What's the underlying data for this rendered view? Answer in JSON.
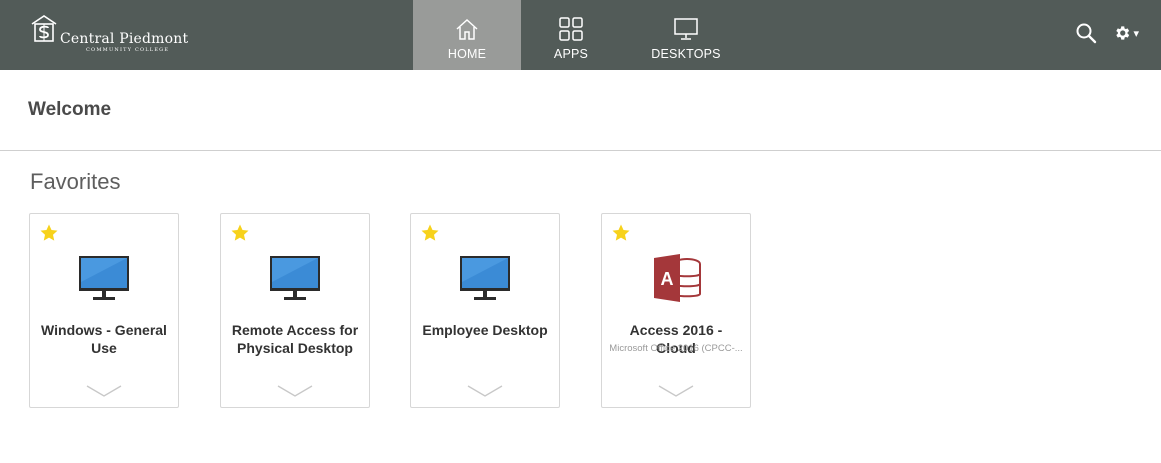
{
  "logo": {
    "name": "Central Piedmont",
    "subtitle": "Community College"
  },
  "nav": {
    "items": [
      {
        "label": "HOME",
        "icon": "home-icon",
        "active": true
      },
      {
        "label": "APPS",
        "icon": "apps-grid-icon",
        "active": false
      },
      {
        "label": "DESKTOPS",
        "icon": "monitor-icon",
        "active": false
      }
    ]
  },
  "tools": {
    "search_icon": "search-icon",
    "settings_icon": "gear-icon",
    "settings_caret": "▾"
  },
  "welcome": {
    "title": "Welcome"
  },
  "favorites": {
    "title": "Favorites",
    "items": [
      {
        "title": "Windows - General Use",
        "subtitle": "",
        "icon": "desktop-monitor-icon",
        "favorite": true
      },
      {
        "title": "Remote Access for Physical Desktop",
        "subtitle": "",
        "icon": "desktop-monitor-icon",
        "favorite": true
      },
      {
        "title": "Employee Desktop",
        "subtitle": "",
        "icon": "desktop-monitor-icon",
        "favorite": true
      },
      {
        "title": "Access 2016 - Cloud",
        "subtitle": "Microsoft Office 2016 (CPCC-...",
        "icon": "ms-access-icon",
        "favorite": true
      }
    ]
  },
  "colors": {
    "topbar": "#525b58",
    "nav_active": "#999b99",
    "star": "#f7d21b",
    "access_red": "#a4373a",
    "monitor_blue": "#3b8bd6"
  }
}
